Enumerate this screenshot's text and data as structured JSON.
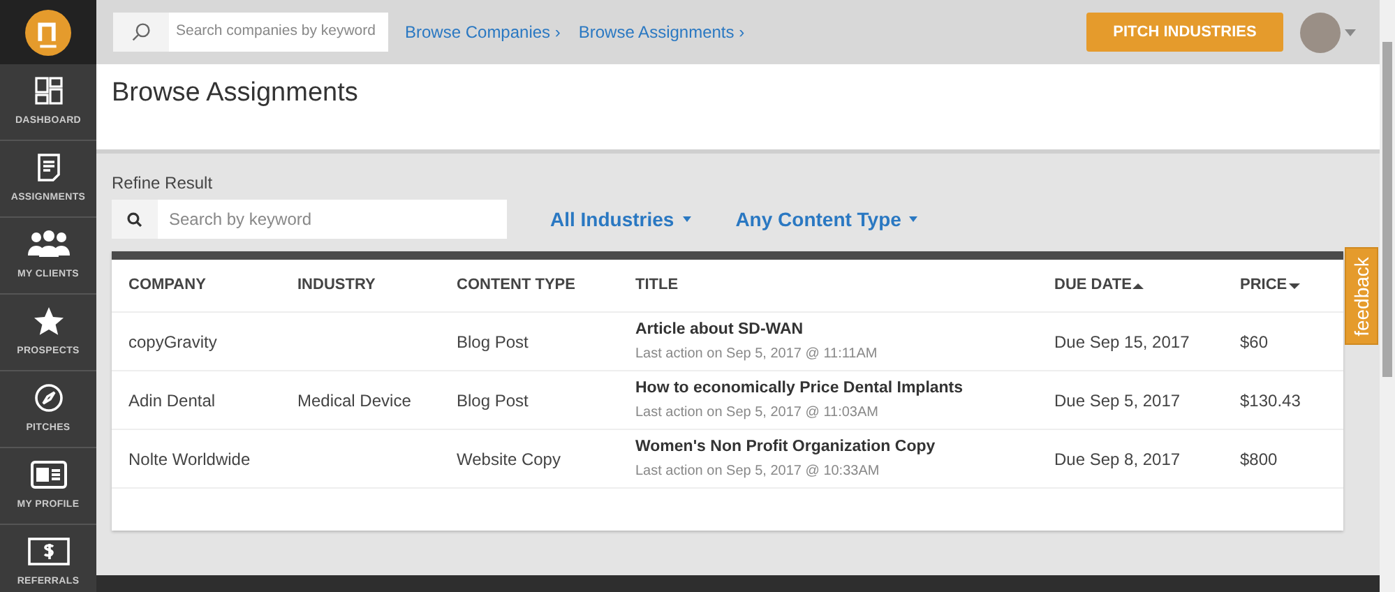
{
  "sidebar": {
    "items": [
      {
        "label": "DASHBOARD"
      },
      {
        "label": "ASSIGNMENTS"
      },
      {
        "label": "MY CLIENTS"
      },
      {
        "label": "PROSPECTS"
      },
      {
        "label": "PITCHES"
      },
      {
        "label": "MY PROFILE"
      },
      {
        "label": "REFERRALS"
      }
    ]
  },
  "topbar": {
    "search": {
      "placeholder": "Search companies by keyword"
    },
    "breadcrumbs": [
      "Browse Companies ›",
      "Browse Assignments ›"
    ],
    "action_button": "PITCH INDUSTRIES"
  },
  "page": {
    "title": "Browse Assignments"
  },
  "filters": {
    "label": "Refine Result",
    "search": {
      "placeholder": "Search by keyword"
    },
    "dropdowns": [
      "All Industries",
      "Any Content Type"
    ]
  },
  "table": {
    "columns": [
      {
        "label": "COMPANY"
      },
      {
        "label": "INDUSTRY"
      },
      {
        "label": "CONTENT TYPE"
      },
      {
        "label": "TITLE"
      },
      {
        "label": "DUE DATE",
        "kind": "ascending"
      },
      {
        "label": "PRICE",
        "kind": "descending"
      }
    ],
    "rows": [
      {
        "company": "copyGravity",
        "industry": "",
        "content_type": "Blog Post",
        "title": "Article about SD-WAN",
        "last_action": "Last action on Sep 5, 2017 @ 11:11AM",
        "due_date": "Due Sep 15, 2017",
        "price": "$60"
      },
      {
        "company": "Adin Dental",
        "industry": "Medical Device",
        "content_type": "Blog Post",
        "title": "How to economically Price Dental Implants",
        "last_action": "Last action on Sep 5, 2017 @ 11:03AM",
        "due_date": "Due Sep 5, 2017",
        "price": "$130.43"
      },
      {
        "company": "Nolte Worldwide",
        "industry": "",
        "content_type": "Website Copy",
        "title": "Women's Non Profit Organization Copy",
        "last_action": "Last action on Sep 5, 2017 @ 10:33AM",
        "due_date": "Due Sep 8, 2017",
        "price": "$800"
      }
    ]
  },
  "feedback_tab": "feedback"
}
